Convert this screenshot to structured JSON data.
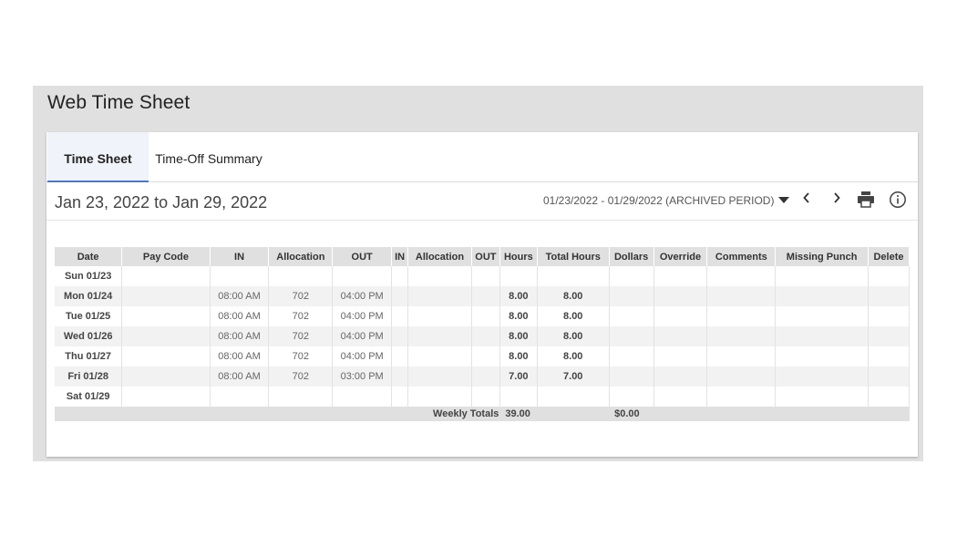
{
  "page": {
    "title": "Web Time Sheet"
  },
  "tabs": [
    {
      "label": "Time Sheet",
      "active": true
    },
    {
      "label": "Time-Off Summary",
      "active": false
    }
  ],
  "period": {
    "range_label": "Jan 23, 2022 to Jan 29, 2022",
    "selector_value": "01/23/2022 - 01/29/2022 (ARCHIVED PERIOD)",
    "prev_glyph": "‹",
    "next_glyph": "›"
  },
  "icons": {
    "dropdown": "caret-down-icon",
    "prev": "chevron-left-icon",
    "next": "chevron-right-icon",
    "print": "printer-icon",
    "info": "info-icon"
  },
  "table": {
    "headers": [
      "Date",
      "Pay Code",
      "IN",
      "Allocation",
      "OUT",
      "IN",
      "Allocation",
      "OUT",
      "Hours",
      "Total Hours",
      "Dollars",
      "Override",
      "Comments",
      "Missing Punch",
      "Delete"
    ],
    "rows": [
      {
        "date": "Sun 01/23",
        "pay_code": "",
        "in1": "",
        "alloc1": "",
        "out1": "",
        "in2": "",
        "alloc2": "",
        "out2": "",
        "hours": "",
        "total_hours": "",
        "dollars": "",
        "override": "",
        "comments": "",
        "missing_punch": "",
        "delete": ""
      },
      {
        "date": "Mon 01/24",
        "pay_code": "",
        "in1": "08:00 AM",
        "alloc1": "702",
        "out1": "04:00 PM",
        "in2": "",
        "alloc2": "",
        "out2": "",
        "hours": "8.00",
        "total_hours": "8.00",
        "dollars": "",
        "override": "",
        "comments": "",
        "missing_punch": "",
        "delete": ""
      },
      {
        "date": "Tue 01/25",
        "pay_code": "",
        "in1": "08:00 AM",
        "alloc1": "702",
        "out1": "04:00 PM",
        "in2": "",
        "alloc2": "",
        "out2": "",
        "hours": "8.00",
        "total_hours": "8.00",
        "dollars": "",
        "override": "",
        "comments": "",
        "missing_punch": "",
        "delete": ""
      },
      {
        "date": "Wed 01/26",
        "pay_code": "",
        "in1": "08:00 AM",
        "alloc1": "702",
        "out1": "04:00 PM",
        "in2": "",
        "alloc2": "",
        "out2": "",
        "hours": "8.00",
        "total_hours": "8.00",
        "dollars": "",
        "override": "",
        "comments": "",
        "missing_punch": "",
        "delete": ""
      },
      {
        "date": "Thu 01/27",
        "pay_code": "",
        "in1": "08:00 AM",
        "alloc1": "702",
        "out1": "04:00 PM",
        "in2": "",
        "alloc2": "",
        "out2": "",
        "hours": "8.00",
        "total_hours": "8.00",
        "dollars": "",
        "override": "",
        "comments": "",
        "missing_punch": "",
        "delete": ""
      },
      {
        "date": "Fri 01/28",
        "pay_code": "",
        "in1": "08:00 AM",
        "alloc1": "702",
        "out1": "03:00 PM",
        "in2": "",
        "alloc2": "",
        "out2": "",
        "hours": "7.00",
        "total_hours": "7.00",
        "dollars": "",
        "override": "",
        "comments": "",
        "missing_punch": "",
        "delete": ""
      },
      {
        "date": "Sat 01/29",
        "pay_code": "",
        "in1": "",
        "alloc1": "",
        "out1": "",
        "in2": "",
        "alloc2": "",
        "out2": "",
        "hours": "",
        "total_hours": "",
        "dollars": "",
        "override": "",
        "comments": "",
        "missing_punch": "",
        "delete": ""
      }
    ],
    "totals": {
      "label": "Weekly Totals",
      "hours": "39.00",
      "dollars": "$0.00"
    }
  },
  "colors": {
    "tab_active_bg": "#f0f3f9",
    "tab_underline": "#4a78c8",
    "header_bg": "#e0e0e0",
    "row_alt": "#f2f2f2"
  }
}
